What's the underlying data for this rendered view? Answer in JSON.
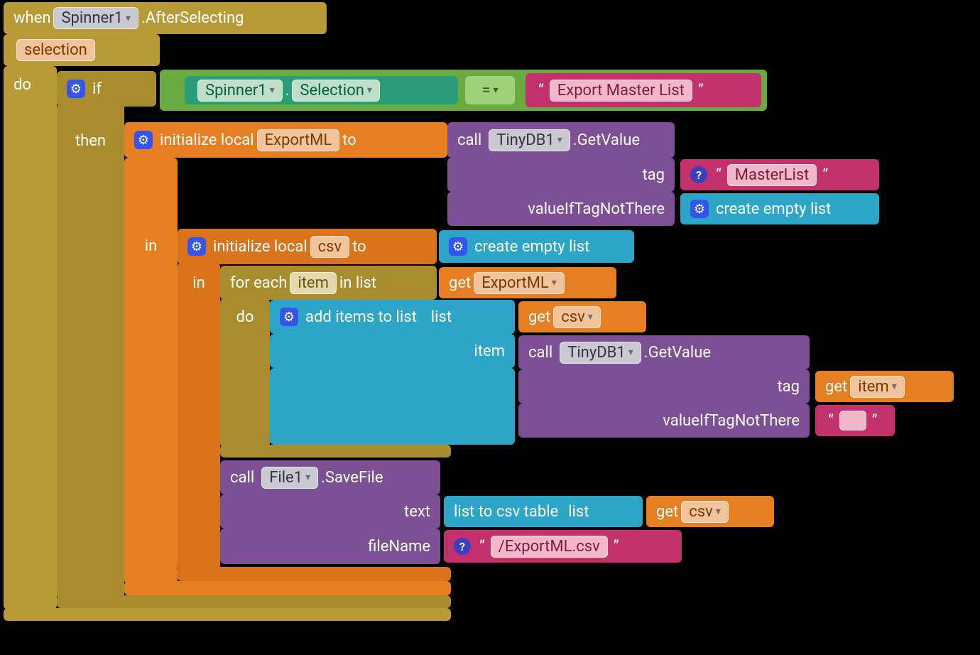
{
  "when": {
    "word": "when",
    "component": "Spinner1",
    "event": ".AfterSelecting",
    "param": "selection",
    "do": "do"
  },
  "if": {
    "word": "if",
    "then": "then",
    "in": "in"
  },
  "cond": {
    "component": "Spinner1",
    "dot": ".",
    "prop": "Selection",
    "op": "=",
    "string": "Export Master List"
  },
  "init1": {
    "word1": "initialize local",
    "var": "ExportML",
    "word2": "to"
  },
  "getval1": {
    "call": "call",
    "component": "TinyDB1",
    "method": ".GetValue",
    "tag": "tag",
    "vnt": "valueIfTagNotThere",
    "tagval": "MasterList"
  },
  "emptylist": "create empty list",
  "init2": {
    "word1": "initialize local",
    "var": "csv",
    "word2": "to"
  },
  "foreach": {
    "word1": "for each",
    "var": "item",
    "word2": "in list",
    "do": "do"
  },
  "getExport": {
    "word": "get",
    "var": "ExportML"
  },
  "additems": {
    "line": "add items to list",
    "list": "list",
    "item": "item"
  },
  "getcsv": {
    "word": "get",
    "var": "csv"
  },
  "getval2": {
    "call": "call",
    "component": "TinyDB1",
    "method": ".GetValue",
    "tag": "tag",
    "vnt": "valueIfTagNotThere"
  },
  "getitem": {
    "word": "get",
    "var": "item"
  },
  "emptystr": "",
  "savefile": {
    "call": "call",
    "component": "File1",
    "method": ".SaveFile",
    "text": "text",
    "fileName": "fileName"
  },
  "tocsv": {
    "word": "list to csv table",
    "list": "list"
  },
  "filenameval": "/ExportML.csv"
}
